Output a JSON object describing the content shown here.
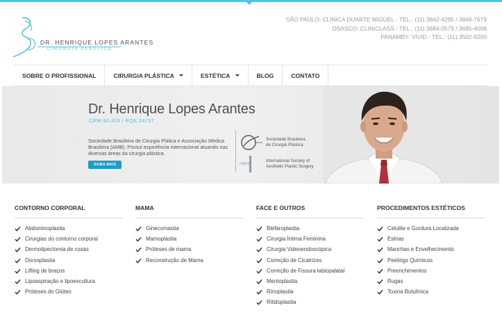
{
  "header": {
    "logo_name": "DR. HENRIQUE LOPES ARANTES",
    "logo_sub": "CIRURGIA PLÁSTICA",
    "contacts": [
      "SÃO PAULO: CLINICA DUARTE MIGUEL - TEL.: (11) 3842-4295 / 3846-7679",
      "OSASCO: CLINICLASS - TEL.: (11) 3684-0579 / 3685-4098",
      "PANAMBY: VIVID - TEL.: (11) 3502-6200"
    ]
  },
  "nav": {
    "items": [
      {
        "label": "SOBRE O PROFISSIONAL"
      },
      {
        "label": "CIRURGIA PLÁSTICA"
      },
      {
        "label": "ESTÉTICA"
      },
      {
        "label": "BLOG"
      },
      {
        "label": "CONTATO"
      }
    ]
  },
  "banner": {
    "name": "Dr. Henrique Lopes Arantes",
    "crm": "CRM 90.405 / RQE 24737",
    "description": "Sociedade Brasileira de Cirurgia Plática e Associação Médica Brasileira (AMB). Possui experiência internacional atuando nas diversas áreas da cirurgia plástica.",
    "button_label": "SAIBA MAIS",
    "society1_line1": "Sociedade Brasileira",
    "society1_line2": "de Cirurgia Plástica",
    "society2_line1": "International Society  of",
    "society2_line2": "Aesthetic Plastic Surgery",
    "society2_abbr": "ISAPS"
  },
  "columns": [
    {
      "title": "CONTORNO CORPORAL",
      "items": [
        "Abdominoplastia",
        "Cirurgias do contorno corporal",
        "Dermolipectomia de coxas",
        "Dorsoplastia",
        "Lifting de braços",
        "Lipoaspiração e lipoescultura",
        "Próteses do Glúteo"
      ]
    },
    {
      "title": "MAMA",
      "items": [
        "Ginecomastia",
        "Mamoplastia",
        "Próteses de mama",
        "Reconstrução de Mama"
      ]
    },
    {
      "title": "FACE E OUTROS",
      "items": [
        "Blefaroplastia",
        "Cirurgia Íntima Feminina",
        "Cirurgia Videoendoscópica",
        "Correção de Cicatrizes",
        "Correção de Fissura labiopalatal",
        "Mentoplastia",
        "Rinoplastia",
        "Ritidoplastia"
      ]
    },
    {
      "title": "PROCEDIMENTOS ESTÉTICOS",
      "items": [
        "Celulite e Gordura Localizada",
        "Estrias",
        "Manchas e Envelhecimento",
        "Peelings Químicos",
        "Preenchimentos",
        "Rugas",
        "Toxina Botulínica"
      ]
    }
  ],
  "colors": {
    "accent": "#4ec3e4",
    "button": "#1f9cc4",
    "text": "#333333"
  }
}
